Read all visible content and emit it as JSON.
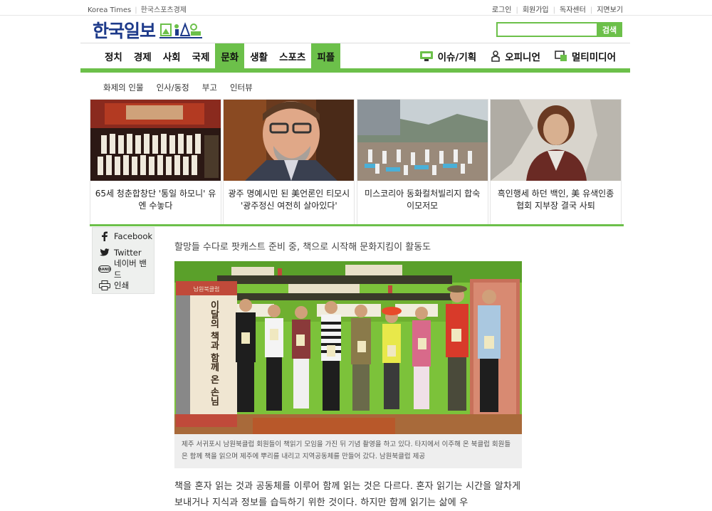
{
  "util": {
    "left": [
      "Korea Times",
      "한국스포츠경제"
    ],
    "right": [
      "로그인",
      "회원가입",
      "독자센터",
      "지면보기"
    ]
  },
  "logo": {
    "text": "한국일보"
  },
  "search": {
    "button": "검색",
    "value": ""
  },
  "gnb": {
    "items": [
      {
        "label": "정치",
        "active": false
      },
      {
        "label": "경제",
        "active": false
      },
      {
        "label": "사회",
        "active": false
      },
      {
        "label": "국제",
        "active": false
      },
      {
        "label": "문화",
        "active": true
      },
      {
        "label": "생활",
        "active": false
      },
      {
        "label": "스포츠",
        "active": false
      },
      {
        "label": "피플",
        "active": true
      }
    ],
    "right": [
      {
        "label": "이슈/기획",
        "icon": "monitor-icon"
      },
      {
        "label": "오피니언",
        "icon": "person-icon"
      },
      {
        "label": "멀티미디어",
        "icon": "media-icon"
      }
    ]
  },
  "subnav": [
    "화제의 인물",
    "인사/동정",
    "부고",
    "인터뷰"
  ],
  "cards": [
    {
      "caption": "65세 청춘합창단 '통일 하모니' 유엔 수놓다"
    },
    {
      "caption": "광주 명예시민 된 美언론인 티모시 '광주정신 여전히 살아있다'"
    },
    {
      "caption": "미스코리아 동화컬처빌리지 합숙 이모저모"
    },
    {
      "caption": "흑인행세 하던 백인, 美 유색인종협회 지부장 결국 사퇴"
    }
  ],
  "share": [
    {
      "label": "Facebook",
      "icon": "facebook-icon"
    },
    {
      "label": "Twitter",
      "icon": "twitter-icon"
    },
    {
      "label": "네이버 밴드",
      "icon": "band-icon"
    },
    {
      "label": "인쇄",
      "icon": "print-icon"
    }
  ],
  "article": {
    "subtitle": "할망들 수다로 팟캐스트 준비 중, 책으로 시작해 문화지킴이 활동도",
    "caption": "제주 서귀포시 남원북클럽 회원들이 책읽기 모임을 가진 뒤 기념 촬영을 하고 있다. 타지에서 이주해 온 북클럽 회원들은 함께 책을 읽으며 제주에 뿌리를 내리고 지역공동체를 만들어 갔다. 남원북클럽 제공",
    "banner": {
      "top": "남원북클럽",
      "title": "이달의 책과 함께 온 손님"
    },
    "body": "책을 혼자 읽는 것과 공동체를 이루어 함께 읽는 것은 다르다. 혼자 읽기는 시간을 알차게 보내거나 지식과 정보를 습득하기 위한 것이다. 하지만 함께 읽기는 삶에 우"
  },
  "colors": {
    "accent": "#6cc04a",
    "logo": "#1d3a8a"
  }
}
